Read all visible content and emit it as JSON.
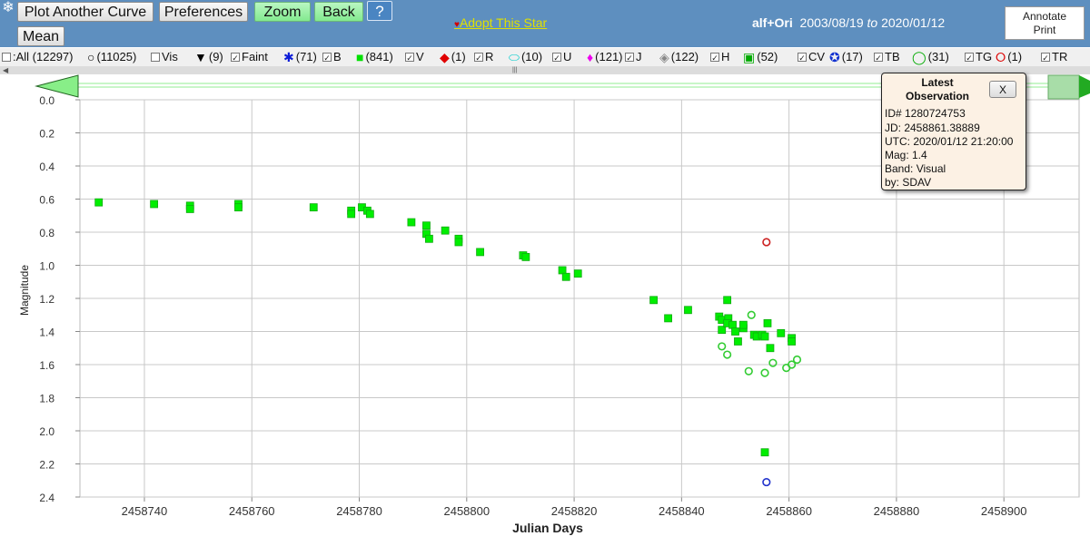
{
  "toolbar": {
    "plot_another": "Plot Another Curve",
    "preferences": "Preferences",
    "zoom": "Zoom",
    "back": "Back",
    "help": "?",
    "mean": "Mean",
    "adopt": "Adopt This Star",
    "star_name": "alf+Ori",
    "date_from": "2003/08/19",
    "date_sep": "to",
    "date_to": "2020/01/12",
    "annotate": "Annotate",
    "print": "Print"
  },
  "legend": [
    {
      "label": ":All (12297)",
      "symbol": "",
      "checked": false
    },
    {
      "label": "(11025)",
      "symbol": "○",
      "checked": false
    },
    {
      "label": "Vis",
      "symbol": "",
      "checked": false
    },
    {
      "label": "(9)",
      "symbol": "▼",
      "checked": true
    },
    {
      "label": "Faint",
      "symbol": "",
      "checked": true
    },
    {
      "label": "(71)",
      "symbol": "✱",
      "checked": true
    },
    {
      "label": "B",
      "symbol": "",
      "checked": true
    },
    {
      "label": "(841)",
      "symbol": "■",
      "checked": true
    },
    {
      "label": "V",
      "symbol": "",
      "checked": true
    },
    {
      "label": "(1)",
      "symbol": "◆",
      "checked": true
    },
    {
      "label": "R",
      "symbol": "",
      "checked": true
    },
    {
      "label": "(10)",
      "symbol": "⬭",
      "checked": true
    },
    {
      "label": "U",
      "symbol": "",
      "checked": true
    },
    {
      "label": "(121)",
      "symbol": "♦",
      "checked": true
    },
    {
      "label": "J",
      "symbol": "",
      "checked": true
    },
    {
      "label": "(122)",
      "symbol": "◈",
      "checked": true
    },
    {
      "label": "H",
      "symbol": "",
      "checked": true
    },
    {
      "label": "(52)",
      "symbol": "▣",
      "checked": true
    },
    {
      "label": "CV",
      "symbol": "",
      "checked": true
    },
    {
      "label": "(17)",
      "symbol": "✪",
      "checked": true
    },
    {
      "label": "TB",
      "symbol": "",
      "checked": true
    },
    {
      "label": "(31)",
      "symbol": "◯",
      "checked": true
    },
    {
      "label": "TG",
      "symbol": "",
      "checked": true
    },
    {
      "label": "(1)",
      "symbol": "⭘",
      "checked": true
    },
    {
      "label": "TR",
      "symbol": "",
      "checked": true
    }
  ],
  "legend_colors": [
    "#000000",
    "#000000",
    "#000000",
    "#000000",
    "#000000",
    "#0b1bd8",
    "#000000",
    "#00e000",
    "#000000",
    "#e00000",
    "#000000",
    "#00cccc",
    "#000000",
    "#ee00ee",
    "#000000",
    "#888888",
    "#000000",
    "#00aa00",
    "#000000",
    "#1030d0",
    "#000000",
    "#00aa00",
    "#000000",
    "#dd0000",
    "#000000"
  ],
  "popup": {
    "title_line1": "Latest",
    "title_line2": "Observation",
    "close": "X",
    "id": "ID# 1280724753",
    "jd": "JD: 2458861.38889",
    "utc": "UTC: 2020/01/12 21:20:00",
    "mag": "Mag: 1.4",
    "band": "Band: Visual",
    "by": "by: SDAV"
  },
  "chart_data": {
    "type": "scatter",
    "xlabel": "Julian Days",
    "ylabel": "Magnitude",
    "xlim": [
      2458728,
      2458914
    ],
    "ylim": [
      0.0,
      2.4
    ],
    "y_inverted": true,
    "grid": true,
    "xticks": [
      2458740,
      2458760,
      2458780,
      2458800,
      2458820,
      2458840,
      2458860,
      2458880,
      2458900
    ],
    "xtick_labels": [
      "2458740",
      "2458760",
      "2458780",
      "2458800",
      "2458820",
      "2458840",
      "2458860",
      "2458880",
      "2458900"
    ],
    "yticks": [
      0.0,
      0.2,
      0.4,
      0.6,
      0.8,
      1.0,
      1.2,
      1.4,
      1.6,
      1.8,
      2.0,
      2.2,
      2.4
    ],
    "ytick_labels": [
      "0.0",
      "0.2",
      "0.4",
      "0.6",
      "0.8",
      "1.0",
      "1.2",
      "1.4",
      "1.6",
      "1.8",
      "2.0",
      "2.2",
      "2.4"
    ],
    "series": [
      {
        "name": "V",
        "marker": "square",
        "color": "#00ee00",
        "x": [
          2458731.5,
          2458741.8,
          2458748.5,
          2458748.5,
          2458757.5,
          2458757.5,
          2458771.5,
          2458778.5,
          2458778.5,
          2458780.5,
          2458781.5,
          2458782,
          2458789.7,
          2458792.5,
          2458792.5,
          2458793,
          2458796,
          2458798.5,
          2458798.5,
          2458802.5,
          2458810.5,
          2458811,
          2458817.8,
          2458818.5,
          2458820.7,
          2458834.8,
          2458837.5,
          2458841.2,
          2458847,
          2458847.5,
          2458847.5,
          2458848.5,
          2458848.7,
          2458848.5,
          2458849.5,
          2458850,
          2458850.5,
          2458851.5,
          2458851.5,
          2458853.5,
          2458854,
          2458855,
          2458855.5,
          2458856,
          2458856.5,
          2458858.5,
          2458860.5,
          2458860.5,
          2458855.5
        ],
        "y": [
          0.62,
          0.63,
          0.64,
          0.66,
          0.63,
          0.65,
          0.65,
          0.67,
          0.69,
          0.65,
          0.67,
          0.69,
          0.74,
          0.76,
          0.81,
          0.84,
          0.79,
          0.84,
          0.86,
          0.92,
          0.94,
          0.95,
          1.03,
          1.07,
          1.05,
          1.21,
          1.32,
          1.27,
          1.31,
          1.33,
          1.39,
          1.21,
          1.32,
          1.35,
          1.36,
          1.4,
          1.46,
          1.38,
          1.36,
          1.42,
          1.43,
          1.42,
          1.43,
          1.35,
          1.5,
          1.41,
          1.44,
          1.46,
          2.13
        ]
      },
      {
        "name": "Vis",
        "marker": "circle-open",
        "color": "#33cc33",
        "x": [
          2458847.5,
          2458848.5,
          2458852.5,
          2458853,
          2458855.5,
          2458857,
          2458859.5,
          2458861.5,
          2458860.5
        ],
        "y": [
          1.49,
          1.54,
          1.64,
          1.3,
          1.65,
          1.59,
          1.62,
          1.57,
          1.6
        ]
      },
      {
        "name": "TR",
        "marker": "circle-open",
        "color": "#cc2222",
        "x": [
          2458855.8
        ],
        "y": [
          0.86
        ]
      },
      {
        "name": "TB",
        "marker": "circle-open",
        "color": "#2233cc",
        "x": [
          2458855.8
        ],
        "y": [
          2.31
        ]
      }
    ]
  }
}
